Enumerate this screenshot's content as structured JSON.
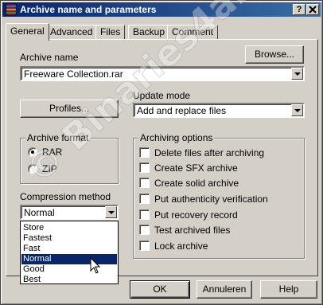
{
  "window": {
    "title": "Archive name and parameters",
    "help_btn": "?",
    "close_btn": "X"
  },
  "tabs": [
    "General",
    "Advanced",
    "Files",
    "Backup",
    "Comment"
  ],
  "general": {
    "archive_name_label": "Archive name",
    "archive_name_value": "Freeware Collection.rar",
    "browse_label": "Browse...",
    "profiles_label": "Profiles...",
    "update_mode_label": "Update mode",
    "update_mode_value": "Add and replace files",
    "archive_format": {
      "title": "Archive format",
      "options": [
        {
          "label": "RAR",
          "checked": true
        },
        {
          "label": "ZIP",
          "checked": false
        }
      ]
    },
    "compression": {
      "label": "Compression method",
      "value": "Normal",
      "options": [
        "Store",
        "Fastest",
        "Fast",
        "Normal",
        "Good",
        "Best"
      ],
      "selected_index": 3
    },
    "archiving_options": {
      "title": "Archiving options",
      "items": [
        {
          "label": "Delete files after archiving",
          "checked": false
        },
        {
          "label": "Create SFX archive",
          "checked": false
        },
        {
          "label": "Create solid archive",
          "checked": false
        },
        {
          "label": "Put authenticity verification",
          "checked": false
        },
        {
          "label": "Put recovery record",
          "checked": false
        },
        {
          "label": "Test archived files",
          "checked": false
        },
        {
          "label": "Lock archive",
          "checked": false
        }
      ]
    }
  },
  "footer": {
    "ok": "OK",
    "cancel": "Annuleren",
    "help": "Help"
  },
  "watermark": "© Binaries4all",
  "colors": {
    "titlebar": "#0a246a",
    "face": "#d4d0c8",
    "selection": "#0a246a"
  }
}
